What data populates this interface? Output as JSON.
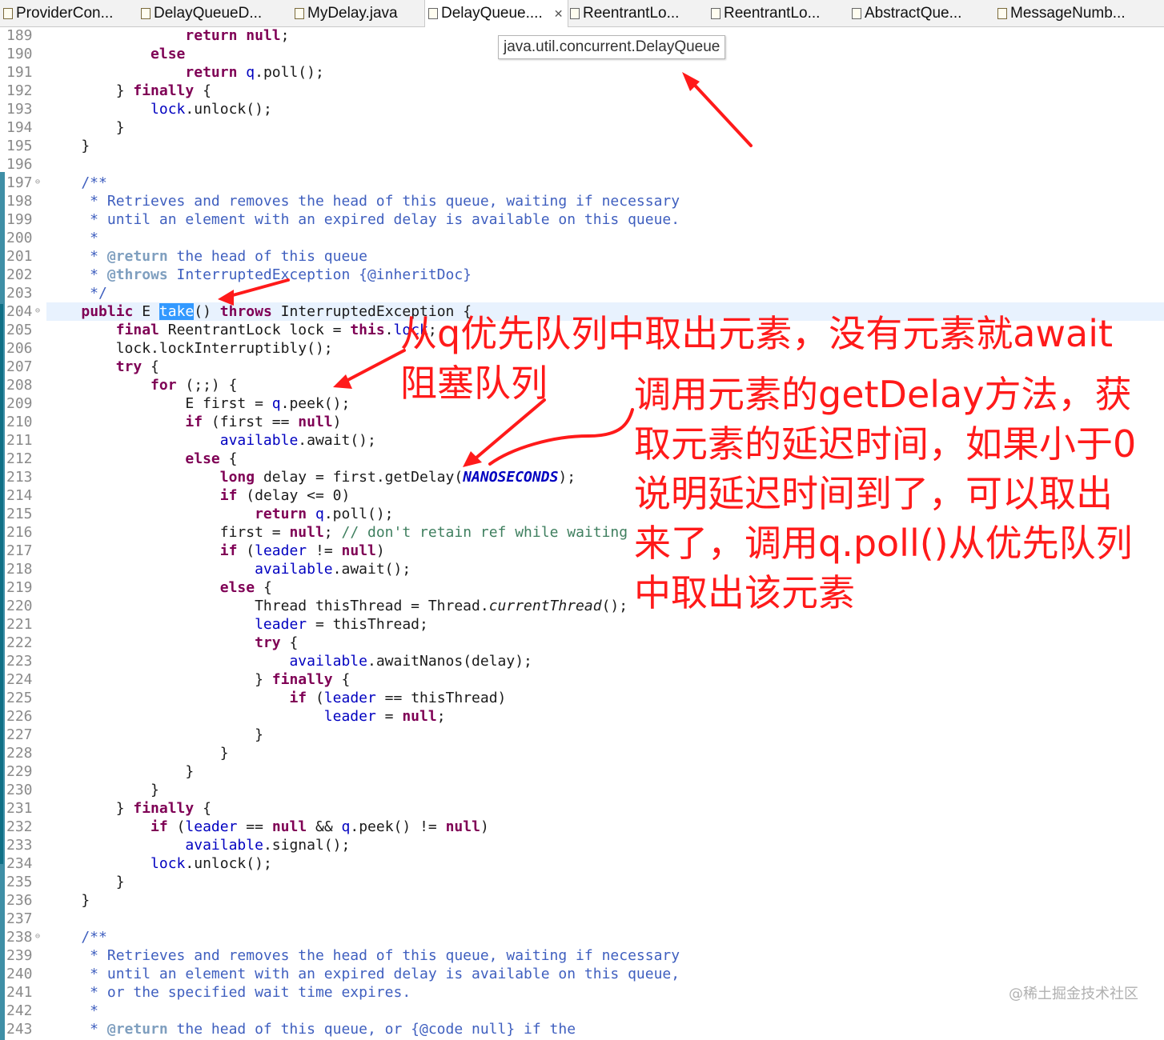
{
  "tabs": [
    {
      "label": "ProviderCon...",
      "icon": "java-file-icon"
    },
    {
      "label": "DelayQueueD...",
      "icon": "java-file-icon"
    },
    {
      "label": "MyDelay.java",
      "icon": "java-file-icon"
    },
    {
      "label": "DelayQueue....",
      "icon": "class-file-icon",
      "close": "✕"
    },
    {
      "label": "ReentrantLo...",
      "icon": "class-file-icon"
    },
    {
      "label": "ReentrantLo...",
      "icon": "class-file-icon"
    },
    {
      "label": "AbstractQue...",
      "icon": "class-file-icon"
    },
    {
      "label": "MessageNumb...",
      "icon": "java-file-icon"
    }
  ],
  "tooltip": "java.util.concurrent.DelayQueue",
  "line_numbers": [
    "189",
    "190",
    "191",
    "192",
    "193",
    "194",
    "195",
    "196",
    "197",
    "198",
    "199",
    "200",
    "201",
    "202",
    "203",
    "204",
    "205",
    "206",
    "207",
    "208",
    "209",
    "210",
    "211",
    "212",
    "213",
    "214",
    "215",
    "216",
    "217",
    "218",
    "219",
    "220",
    "221",
    "222",
    "223",
    "224",
    "225",
    "226",
    "227",
    "228",
    "229",
    "230",
    "231",
    "232",
    "233",
    "234",
    "235",
    "236",
    "237",
    "238",
    "239",
    "240",
    "241",
    "242",
    "243"
  ],
  "fold_marker": "⊖",
  "code_lines": [
    [
      [
        "                ",
        ""
      ],
      [
        "return",
        "kw"
      ],
      [
        " ",
        ""
      ],
      [
        "null",
        "kw"
      ],
      [
        ";",
        ""
      ]
    ],
    [
      [
        "            ",
        ""
      ],
      [
        "else",
        "kw"
      ]
    ],
    [
      [
        "                ",
        ""
      ],
      [
        "return",
        "kw"
      ],
      [
        " ",
        ""
      ],
      [
        "q",
        "fld"
      ],
      [
        ".poll();",
        ""
      ]
    ],
    [
      [
        "        } ",
        ""
      ],
      [
        "finally",
        "kw"
      ],
      [
        " {",
        ""
      ]
    ],
    [
      [
        "            ",
        ""
      ],
      [
        "lock",
        "fld"
      ],
      [
        ".unlock();",
        ""
      ]
    ],
    [
      [
        "        }",
        ""
      ]
    ],
    [
      [
        "    }",
        ""
      ]
    ],
    [
      [
        "",
        ""
      ]
    ],
    [
      [
        "    /**",
        "cmt"
      ]
    ],
    [
      [
        "     * Retrieves and removes the head of this queue, waiting if necessary",
        "cmt"
      ]
    ],
    [
      [
        "     * until an element with an expired delay is available on this queue.",
        "cmt"
      ]
    ],
    [
      [
        "     *",
        "cmt"
      ]
    ],
    [
      [
        "     * ",
        "cmt"
      ],
      [
        "@return",
        "tag"
      ],
      [
        " the head of this queue",
        "cmt"
      ]
    ],
    [
      [
        "     * ",
        "cmt"
      ],
      [
        "@throws",
        "tag"
      ],
      [
        " InterruptedException {@inheritDoc}",
        "cmt"
      ]
    ],
    [
      [
        "     */",
        "cmt"
      ]
    ],
    [
      [
        "    ",
        ""
      ],
      [
        "public",
        "kw"
      ],
      [
        " E ",
        ""
      ],
      [
        "take",
        "sel"
      ],
      [
        "() ",
        ""
      ],
      [
        "throws",
        "kw"
      ],
      [
        " InterruptedException {",
        ""
      ]
    ],
    [
      [
        "        ",
        ""
      ],
      [
        "final",
        "kw"
      ],
      [
        " ReentrantLock lock = ",
        ""
      ],
      [
        "this",
        "kw"
      ],
      [
        ".",
        ""
      ],
      [
        "lock",
        "fld"
      ],
      [
        ";",
        ""
      ]
    ],
    [
      [
        "        lock.lockInterruptibly();",
        ""
      ]
    ],
    [
      [
        "        ",
        ""
      ],
      [
        "try",
        "kw"
      ],
      [
        " {",
        ""
      ]
    ],
    [
      [
        "            ",
        ""
      ],
      [
        "for",
        "kw"
      ],
      [
        " (;;) {",
        ""
      ]
    ],
    [
      [
        "                E first = ",
        ""
      ],
      [
        "q",
        "fld"
      ],
      [
        ".peek();",
        ""
      ]
    ],
    [
      [
        "                ",
        ""
      ],
      [
        "if",
        "kw"
      ],
      [
        " (first == ",
        ""
      ],
      [
        "null",
        "kw"
      ],
      [
        ")",
        ""
      ]
    ],
    [
      [
        "                    ",
        ""
      ],
      [
        "available",
        "fld"
      ],
      [
        ".await();",
        ""
      ]
    ],
    [
      [
        "                ",
        ""
      ],
      [
        "else",
        "kw"
      ],
      [
        " {",
        ""
      ]
    ],
    [
      [
        "                    ",
        ""
      ],
      [
        "long",
        "kw"
      ],
      [
        " delay = first.getDelay(",
        ""
      ],
      [
        "NANOSECONDS",
        "const"
      ],
      [
        ");",
        ""
      ]
    ],
    [
      [
        "                    ",
        ""
      ],
      [
        "if",
        "kw"
      ],
      [
        " (delay <= 0)",
        ""
      ]
    ],
    [
      [
        "                        ",
        ""
      ],
      [
        "return",
        "kw"
      ],
      [
        " ",
        ""
      ],
      [
        "q",
        "fld"
      ],
      [
        ".poll();",
        ""
      ]
    ],
    [
      [
        "                    first = ",
        ""
      ],
      [
        "null",
        "kw"
      ],
      [
        "; ",
        ""
      ],
      [
        "// don't retain ref while waiting",
        "lcm"
      ]
    ],
    [
      [
        "                    ",
        ""
      ],
      [
        "if",
        "kw"
      ],
      [
        " (",
        ""
      ],
      [
        "leader",
        "fld"
      ],
      [
        " != ",
        ""
      ],
      [
        "null",
        "kw"
      ],
      [
        ")",
        ""
      ]
    ],
    [
      [
        "                        ",
        ""
      ],
      [
        "available",
        "fld"
      ],
      [
        ".await();",
        ""
      ]
    ],
    [
      [
        "                    ",
        ""
      ],
      [
        "else",
        "kw"
      ],
      [
        " {",
        ""
      ]
    ],
    [
      [
        "                        Thread thisThread = Thread.",
        ""
      ],
      [
        "currentThread",
        "it"
      ],
      [
        "();",
        ""
      ]
    ],
    [
      [
        "                        ",
        ""
      ],
      [
        "leader",
        "fld"
      ],
      [
        " = thisThread;",
        ""
      ]
    ],
    [
      [
        "                        ",
        ""
      ],
      [
        "try",
        "kw"
      ],
      [
        " {",
        ""
      ]
    ],
    [
      [
        "                            ",
        ""
      ],
      [
        "available",
        "fld"
      ],
      [
        ".awaitNanos(delay);",
        ""
      ]
    ],
    [
      [
        "                        } ",
        ""
      ],
      [
        "finally",
        "kw"
      ],
      [
        " {",
        ""
      ]
    ],
    [
      [
        "                            ",
        ""
      ],
      [
        "if",
        "kw"
      ],
      [
        " (",
        ""
      ],
      [
        "leader",
        "fld"
      ],
      [
        " == thisThread)",
        ""
      ]
    ],
    [
      [
        "                                ",
        ""
      ],
      [
        "leader",
        "fld"
      ],
      [
        " = ",
        ""
      ],
      [
        "null",
        "kw"
      ],
      [
        ";",
        ""
      ]
    ],
    [
      [
        "                        }",
        ""
      ]
    ],
    [
      [
        "                    }",
        ""
      ]
    ],
    [
      [
        "                }",
        ""
      ]
    ],
    [
      [
        "            }",
        ""
      ]
    ],
    [
      [
        "        } ",
        ""
      ],
      [
        "finally",
        "kw"
      ],
      [
        " {",
        ""
      ]
    ],
    [
      [
        "            ",
        ""
      ],
      [
        "if",
        "kw"
      ],
      [
        " (",
        ""
      ],
      [
        "leader",
        "fld"
      ],
      [
        " == ",
        ""
      ],
      [
        "null",
        "kw"
      ],
      [
        " && ",
        ""
      ],
      [
        "q",
        "fld"
      ],
      [
        ".peek() != ",
        ""
      ],
      [
        "null",
        "kw"
      ],
      [
        ")",
        ""
      ]
    ],
    [
      [
        "                ",
        ""
      ],
      [
        "available",
        "fld"
      ],
      [
        ".signal();",
        ""
      ]
    ],
    [
      [
        "            ",
        ""
      ],
      [
        "lock",
        "fld"
      ],
      [
        ".unlock();",
        ""
      ]
    ],
    [
      [
        "        }",
        ""
      ]
    ],
    [
      [
        "    }",
        ""
      ]
    ],
    [
      [
        "",
        ""
      ]
    ],
    [
      [
        "    /**",
        "cmt"
      ]
    ],
    [
      [
        "     * Retrieves and removes the head of this queue, waiting if necessary",
        "cmt"
      ]
    ],
    [
      [
        "     * until an element with an expired delay is available on this queue,",
        "cmt"
      ]
    ],
    [
      [
        "     * or the specified wait time expires.",
        "cmt"
      ]
    ],
    [
      [
        "     *",
        "cmt"
      ]
    ],
    [
      [
        "     * ",
        "cmt"
      ],
      [
        "@return",
        "tag"
      ],
      [
        " the head of this queue, or {@code null} if the",
        "cmt"
      ]
    ]
  ],
  "annotations": {
    "take_note_line1": "从q优先队列中取出元素，没有元素就await",
    "take_note_line2": "阻塞队列",
    "delay_note": [
      "调用元素的getDelay方法，获",
      "取元素的延迟时间，如果小于0",
      "说明延迟时间到了，可以取出",
      "来了，调用q.poll()从优先队列",
      "中取出该元素"
    ],
    "color": "#ff1a1a"
  },
  "watermark": "@稀土掘金技术社区"
}
